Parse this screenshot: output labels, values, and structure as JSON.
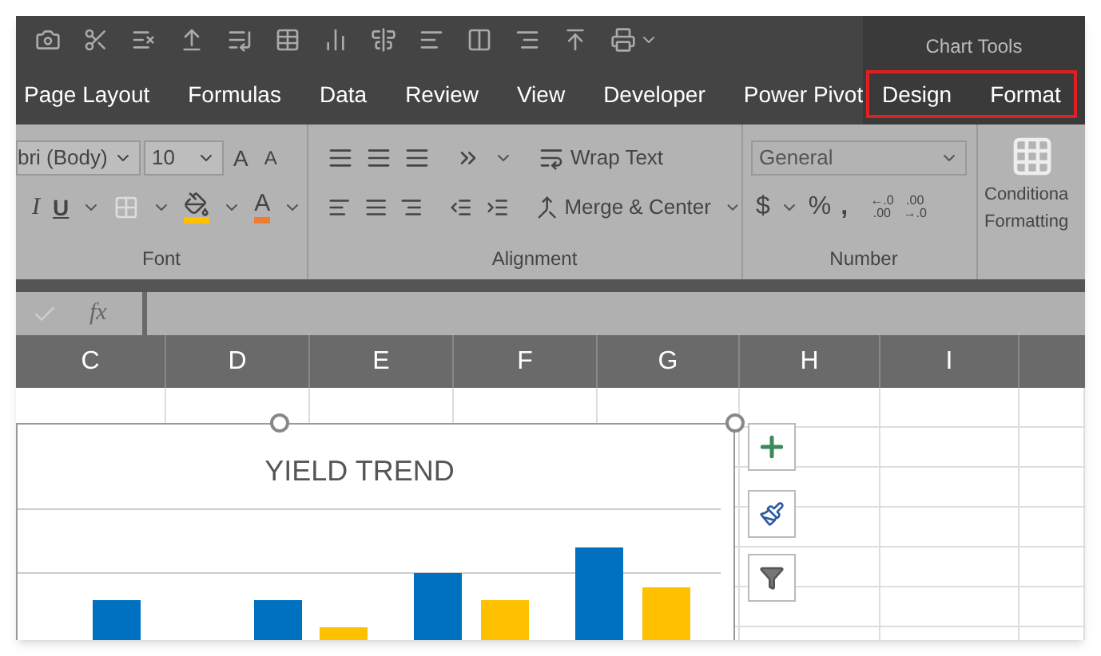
{
  "tabs": [
    {
      "label": "Page Layout"
    },
    {
      "label": "Formulas"
    },
    {
      "label": "Data"
    },
    {
      "label": "Review"
    },
    {
      "label": "View"
    },
    {
      "label": "Developer"
    },
    {
      "label": "Power Pivot"
    }
  ],
  "chart_tools": {
    "label": "Chart Tools",
    "highlighted": true,
    "tabs": [
      {
        "label": "Design"
      },
      {
        "label": "Format"
      }
    ]
  },
  "font_group": {
    "font_name": "bri (Body)",
    "font_size": "10",
    "grow": "A",
    "shrink": "A",
    "italic": "I",
    "underline": "U",
    "font_color": "A",
    "label": "Font"
  },
  "alignment_group": {
    "wrap_text": "Wrap Text",
    "merge_center": "Merge & Center",
    "label": "Alignment"
  },
  "number_group": {
    "format": "General",
    "currency": "$",
    "percent": "%",
    "comma": ",",
    "increase_decimal": [
      "←.0",
      ".00"
    ],
    "decrease_decimal": [
      ".00",
      "→.0"
    ],
    "label": "Number"
  },
  "conditional": {
    "lines": [
      "Conditiona",
      "Formatting"
    ]
  },
  "formula_bar": {
    "fx": "fx"
  },
  "columns": [
    "C",
    "D",
    "E",
    "F",
    "G",
    "H",
    "I"
  ],
  "chart": {
    "title": "YIELD TREND"
  }
}
